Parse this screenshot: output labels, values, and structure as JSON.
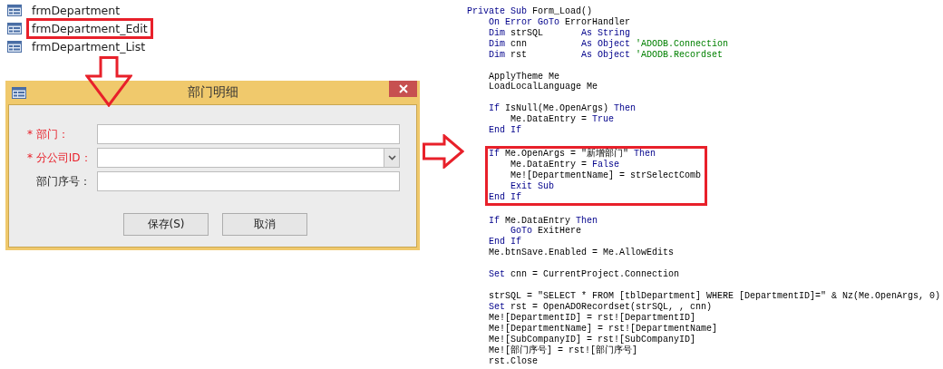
{
  "object_list": [
    {
      "label": "frmDepartment",
      "highlighted": false
    },
    {
      "label": "frmDepartment_Edit",
      "highlighted": true
    },
    {
      "label": "frmDepartment_List",
      "highlighted": false
    }
  ],
  "dialog": {
    "title": "部门明细",
    "fields": [
      {
        "label": "* 部门：",
        "required": true,
        "kind": "text"
      },
      {
        "label": "* 分公司ID：",
        "required": true,
        "kind": "combo"
      },
      {
        "label": "部门序号：",
        "required": false,
        "kind": "text"
      }
    ],
    "buttons": [
      "保存(S)",
      "取消"
    ]
  },
  "code": {
    "blocks": [
      {
        "highlighted": false,
        "lines": [
          {
            "kind": "code",
            "segments": [
              {
                "text": "Private Sub",
                "kind": "keyword"
              },
              {
                "text": " Form_Load()",
                "kind": "plain"
              }
            ]
          },
          {
            "kind": "code",
            "segments": [
              {
                "text": "    On Error GoTo",
                "kind": "keyword"
              },
              {
                "text": " ErrorHandler",
                "kind": "plain"
              }
            ]
          },
          {
            "kind": "code",
            "segments": [
              {
                "text": "    Dim",
                "kind": "keyword"
              },
              {
                "text": " strSQL       ",
                "kind": "plain"
              },
              {
                "text": "As String",
                "kind": "keyword"
              }
            ]
          },
          {
            "kind": "code",
            "segments": [
              {
                "text": "    Dim",
                "kind": "keyword"
              },
              {
                "text": " cnn          ",
                "kind": "plain"
              },
              {
                "text": "As Object",
                "kind": "keyword"
              },
              {
                "text": " 'ADODB.Connection",
                "kind": "comment"
              }
            ]
          },
          {
            "kind": "code",
            "segments": [
              {
                "text": "    Dim",
                "kind": "keyword"
              },
              {
                "text": " rst          ",
                "kind": "plain"
              },
              {
                "text": "As Object",
                "kind": "keyword"
              },
              {
                "text": " 'ADODB.Recordset",
                "kind": "comment"
              }
            ]
          },
          {
            "kind": "blank"
          },
          {
            "kind": "code",
            "segments": [
              {
                "text": "    ApplyTheme Me",
                "kind": "plain"
              }
            ]
          },
          {
            "kind": "code",
            "segments": [
              {
                "text": "    LoadLocalLanguage Me",
                "kind": "plain"
              }
            ]
          },
          {
            "kind": "blank"
          },
          {
            "kind": "code",
            "segments": [
              {
                "text": "    If",
                "kind": "keyword"
              },
              {
                "text": " IsNull(Me.OpenArgs) ",
                "kind": "plain"
              },
              {
                "text": "Then",
                "kind": "keyword"
              }
            ]
          },
          {
            "kind": "code",
            "segments": [
              {
                "text": "        Me.DataEntry = ",
                "kind": "plain"
              },
              {
                "text": "True",
                "kind": "keyword"
              }
            ]
          },
          {
            "kind": "code",
            "segments": [
              {
                "text": "    End If",
                "kind": "keyword"
              }
            ]
          },
          {
            "kind": "blank"
          }
        ]
      },
      {
        "highlighted": true,
        "lines": [
          {
            "kind": "code",
            "segments": [
              {
                "text": "    If",
                "kind": "keyword"
              },
              {
                "text": " Me.OpenArgs = \"新增部门\" ",
                "kind": "plain"
              },
              {
                "text": "Then",
                "kind": "keyword"
              }
            ]
          },
          {
            "kind": "code",
            "segments": [
              {
                "text": "        Me.DataEntry = ",
                "kind": "plain"
              },
              {
                "text": "False",
                "kind": "keyword"
              }
            ]
          },
          {
            "kind": "code",
            "segments": [
              {
                "text": "        Me![DepartmentName] = strSelectComb",
                "kind": "plain"
              }
            ]
          },
          {
            "kind": "code",
            "segments": [
              {
                "text": "        Exit Sub",
                "kind": "keyword"
              }
            ]
          },
          {
            "kind": "code",
            "segments": [
              {
                "text": "    End If",
                "kind": "keyword"
              }
            ]
          }
        ]
      },
      {
        "highlighted": false,
        "lines": [
          {
            "kind": "blank"
          },
          {
            "kind": "code",
            "segments": [
              {
                "text": "    If",
                "kind": "keyword"
              },
              {
                "text": " Me.DataEntry ",
                "kind": "plain"
              },
              {
                "text": "Then",
                "kind": "keyword"
              }
            ]
          },
          {
            "kind": "code",
            "segments": [
              {
                "text": "        GoTo",
                "kind": "keyword"
              },
              {
                "text": " ExitHere",
                "kind": "plain"
              }
            ]
          },
          {
            "kind": "code",
            "segments": [
              {
                "text": "    End If",
                "kind": "keyword"
              }
            ]
          },
          {
            "kind": "code",
            "segments": [
              {
                "text": "    Me.btnSave.Enabled = Me.AllowEdits",
                "kind": "plain"
              }
            ]
          },
          {
            "kind": "blank"
          },
          {
            "kind": "code",
            "segments": [
              {
                "text": "    Set",
                "kind": "keyword"
              },
              {
                "text": " cnn = CurrentProject.Connection",
                "kind": "plain"
              }
            ]
          },
          {
            "kind": "blank"
          },
          {
            "kind": "code",
            "segments": [
              {
                "text": "    strSQL = \"SELECT * FROM [tblDepartment] WHERE [DepartmentID]=\" & Nz(Me.OpenArgs, 0)",
                "kind": "plain"
              }
            ]
          },
          {
            "kind": "code",
            "segments": [
              {
                "text": "    Set",
                "kind": "keyword"
              },
              {
                "text": " rst = OpenADORecordset(strSQL, , cnn)",
                "kind": "plain"
              }
            ]
          },
          {
            "kind": "code",
            "segments": [
              {
                "text": "    Me![DepartmentID] = rst![DepartmentID]",
                "kind": "plain"
              }
            ]
          },
          {
            "kind": "code",
            "segments": [
              {
                "text": "    Me![DepartmentName] = rst![DepartmentName]",
                "kind": "plain"
              }
            ]
          },
          {
            "kind": "code",
            "segments": [
              {
                "text": "    Me![SubCompanyID] = rst![SubCompanyID]",
                "kind": "plain"
              }
            ]
          },
          {
            "kind": "code",
            "segments": [
              {
                "text": "    Me![部门序号] = rst![部门序号]",
                "kind": "plain"
              }
            ]
          },
          {
            "kind": "code",
            "segments": [
              {
                "text": "    rst.Close",
                "kind": "plain"
              }
            ]
          }
        ]
      }
    ]
  }
}
